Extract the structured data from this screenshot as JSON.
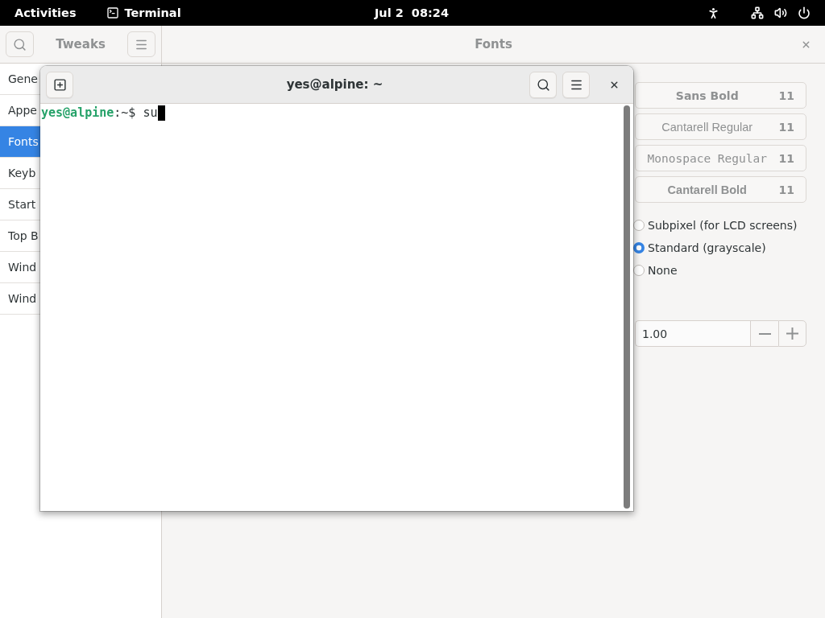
{
  "top_bar": {
    "activities": "Activities",
    "app_menu": "Terminal",
    "clock": "Jul 2  08:24"
  },
  "tweaks_window": {
    "title": "Tweaks",
    "page_title": "Fonts",
    "sidebar": [
      {
        "label": "Gene",
        "selected": false
      },
      {
        "label": "Appe",
        "selected": false
      },
      {
        "label": "Fonts",
        "selected": true
      },
      {
        "label": "Keyb",
        "selected": false
      },
      {
        "label": "Start",
        "selected": false
      },
      {
        "label": "Top B",
        "selected": false
      },
      {
        "label": "Wind",
        "selected": false
      },
      {
        "label": "Wind",
        "selected": false
      }
    ],
    "font_buttons": [
      {
        "kind": "sansbold",
        "font": "Sans Bold",
        "size": "11"
      },
      {
        "kind": "regular",
        "font": "Cantarell Regular",
        "size": "11"
      },
      {
        "kind": "mono",
        "font": "Monospace Regular",
        "size": "11"
      },
      {
        "kind": "bold",
        "font": "Cantarell Bold",
        "size": "11"
      }
    ],
    "antialiasing": [
      {
        "label": "Subpixel (for LCD screens)",
        "selected": false
      },
      {
        "label": "Standard (grayscale)",
        "selected": true
      },
      {
        "label": "None",
        "selected": false
      }
    ],
    "scaling_factor": {
      "value": "1.00"
    }
  },
  "terminal_window": {
    "title": "yes@alpine: ~",
    "prompt_line": "**yes@alpine**:~$ su"
  }
}
